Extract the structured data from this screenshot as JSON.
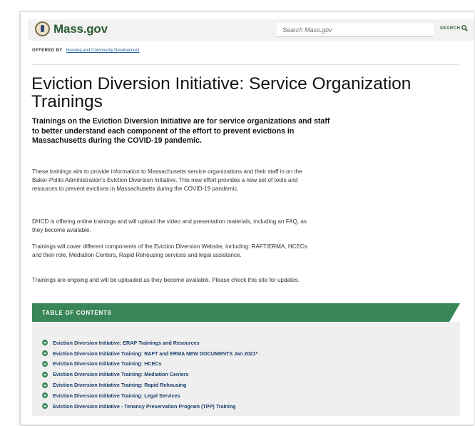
{
  "header": {
    "logo_text": "Mass.gov",
    "search_placeholder": "Search Mass.gov",
    "search_button": "SEARCH"
  },
  "offered_by": {
    "label": "OFFERED BY",
    "org": "Housing and Community Development"
  },
  "page": {
    "title": "Eviction Diversion Initiative: Service Organization Trainings",
    "lede": "Trainings on the Eviction Diversion Initiative are for service organizations and staff to better understand each component of the effort to prevent evictions in Massachusetts during the COVID-19 pandemic.",
    "paragraphs": [
      "These trainings aim to provide information to Massachusetts service organizations and their staff in on the Baker-Polito Administration's Eviction Diversion Initiative. This new effort provides a new set of tools and resources to prevent evictions in Massachusetts during the COVID-19 pandemic.",
      "DHCD is offering online trainings and will upload the video and presentation materials, including an FAQ, as they become available.",
      "Trainings will cover different components of the Eviction Diversion Website, including: RAFT/ERMA, HCECs and their role, Mediation Centers, Rapid Rehousing services and legal assistance.",
      "Trainings are ongoing and will be uploaded as they become available. Please check this site for updates."
    ]
  },
  "toc": {
    "title": "TABLE OF CONTENTS",
    "items": [
      "Eviction Diversion Initiative: ERAP Trainings and Resources",
      "Eviction Diversion Initiative Training: RAFT and ERMA NEW DOCUMENTS Jan 2021*",
      "Eviction Diversion Initiative Training: HCECs",
      "Eviction Diversion Initiative Training: Mediation Centers",
      "Eviction Diversion Initiative Training: Rapid Rehousing",
      "Eviction Diversion Initiative Training: Legal Services",
      "Eviction Diversion Initiative - Tenancy Preservation Program (TPP) Training"
    ]
  },
  "colors": {
    "brand_green": "#388557",
    "logo_green": "#2b5c35",
    "link_blue": "#1b3f6b"
  }
}
